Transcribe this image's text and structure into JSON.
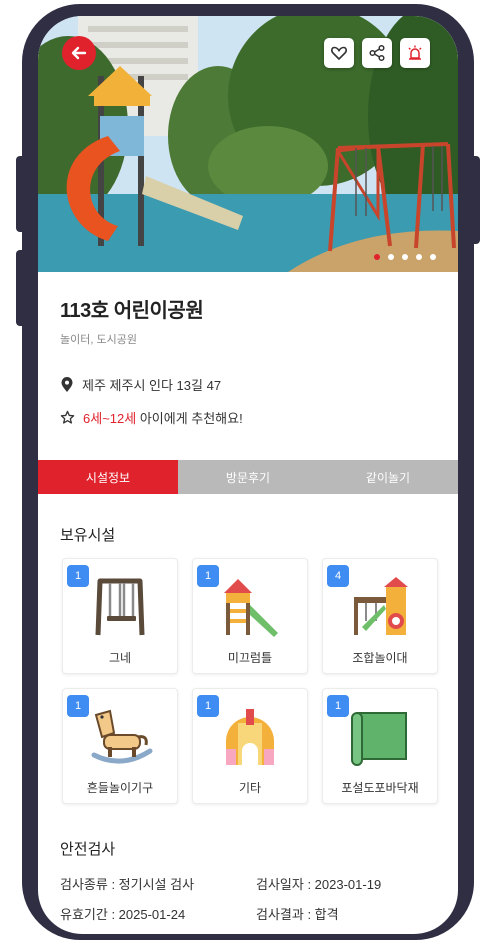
{
  "place": {
    "title": "113호 어린이공원",
    "categories": "놀이터, 도시공원",
    "address": "제주 제주시 인다 13길 47",
    "age_range": "6세~12세",
    "recommend_suffix": " 아이에게 추천해요!"
  },
  "icons": {
    "back": "arrow-left-icon",
    "favorite": "heart-icon",
    "share": "share-icon",
    "report": "alarm-siren-icon",
    "location": "location-pin-icon",
    "recommend": "star-icon"
  },
  "gallery": {
    "total": 5,
    "current_index": 1
  },
  "tabs": [
    {
      "label": "시설정보",
      "active": true
    },
    {
      "label": "방문후기",
      "active": false
    },
    {
      "label": "같이놀기",
      "active": false
    }
  ],
  "facilities": {
    "section_title": "보유시설",
    "items": [
      {
        "label": "그네",
        "count": "1",
        "icon": "swing-icon"
      },
      {
        "label": "미끄럼틀",
        "count": "1",
        "icon": "slide-icon"
      },
      {
        "label": "조합놀이대",
        "count": "4",
        "icon": "combination-play-structure-icon"
      },
      {
        "label": "흔들놀이기구",
        "count": "1",
        "icon": "rocking-horse-icon"
      },
      {
        "label": "기타",
        "count": "1",
        "icon": "blocks-icon"
      },
      {
        "label": "포설도포바닥재",
        "count": "1",
        "icon": "floor-mat-icon"
      }
    ]
  },
  "safety": {
    "section_title": "안전검사",
    "type_label": "검사종류 : 정기시설 검사",
    "date_label": "검사일자 : 2023-01-19",
    "valid_label": "유효기간 : 2025-01-24",
    "result_label": "검사결과 : 합격"
  },
  "colors": {
    "accent": "#e0222d",
    "badge": "#3f8cf2",
    "tab_inactive": "#b9b9b9",
    "frame": "#2f2e43"
  }
}
